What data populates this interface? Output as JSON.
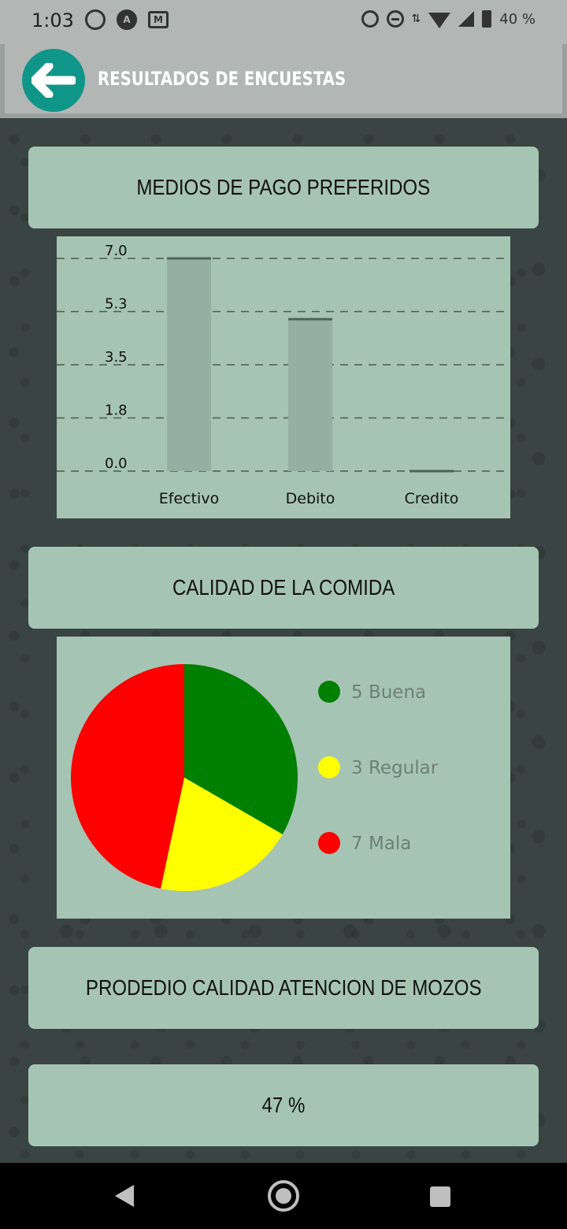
{
  "status_bar": {
    "time": "1:03",
    "battery": "40 %",
    "icons_left": [
      "whatsapp-icon",
      "app-a-icon",
      "gmail-icon"
    ],
    "icons_right": [
      "alarm-icon",
      "dnd-icon",
      "data-arrows-icon",
      "wifi-icon",
      "signal-icon",
      "battery-icon"
    ]
  },
  "app_bar": {
    "title": "RESULTADOS DE ENCUESTAS",
    "back_icon": "arrow-left-icon"
  },
  "sections": {
    "payment_title": "MEDIOS DE PAGO PREFERIDOS",
    "food_title": "CALIDAD DE LA COMIDA",
    "waiters_title": "PRODEDIO CALIDAD ATENCION DE MOZOS",
    "waiters_value": "47 %"
  },
  "colors": {
    "card": "#a6c4b4",
    "bar": "#94b0a2",
    "accent": "#0f9688",
    "pie_buena": "#008000",
    "pie_regular": "#ffff00",
    "pie_mala": "#ff0000"
  },
  "chart_data": [
    {
      "type": "bar",
      "categories": [
        "Efectivo",
        "Debito",
        "Credito"
      ],
      "values": [
        7,
        5,
        0
      ],
      "yticks": [
        "0.0",
        "1.8",
        "3.5",
        "5.3",
        "7.0"
      ],
      "ylim": [
        0,
        7
      ],
      "grid": true
    },
    {
      "type": "pie",
      "labels": [
        "Buena",
        "Regular",
        "Mala"
      ],
      "values": [
        5,
        3,
        7
      ],
      "legend": [
        "5 Buena",
        "3 Regular",
        "7 Mala"
      ],
      "legend_placement": "right"
    }
  ]
}
